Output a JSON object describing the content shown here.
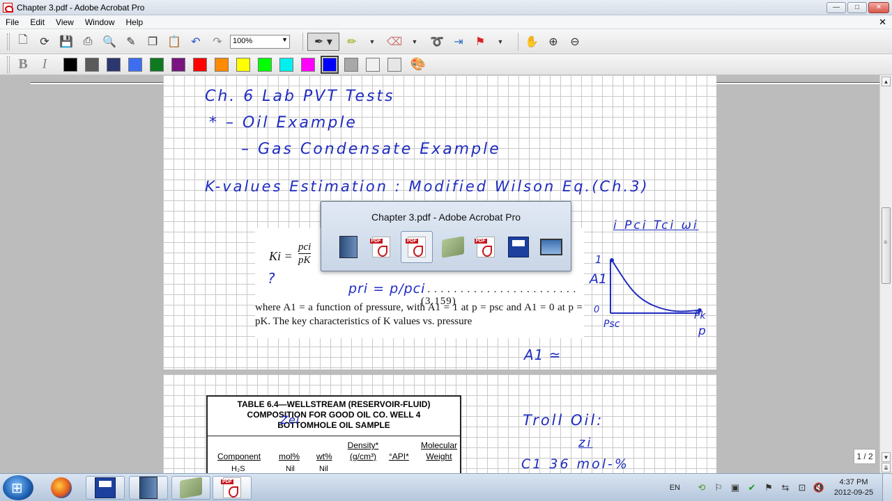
{
  "window": {
    "title": "Chapter 3.pdf - Adobe Acrobat Pro",
    "min": "—",
    "max": "□",
    "close": "✕"
  },
  "menu": {
    "items": [
      "File",
      "Edit",
      "View",
      "Window",
      "Help"
    ],
    "close_doc": "✕"
  },
  "toolbar": {
    "zoom_value": "100%",
    "icons": [
      "create-icon",
      "organizer-icon",
      "save-icon",
      "print-icon",
      "search-icon",
      "tools-icon",
      "copy-icon",
      "paste-icon",
      "undo-icon",
      "redo-icon"
    ],
    "annot_icons": [
      "pen-icon",
      "highlighter-icon",
      "eraser-icon",
      "lasso-icon",
      "insert-space-icon",
      "flag-icon",
      "hand-icon",
      "zoom-in-icon",
      "zoom-out-icon"
    ]
  },
  "format_toolbar": {
    "bold": "B",
    "italic": "I",
    "colors": [
      "#000000",
      "#5a5a5a",
      "#2c3770",
      "#3d6ef0",
      "#0d7a1f",
      "#7a1480",
      "#ff0000",
      "#ff8a00",
      "#ffff00",
      "#00ff00",
      "#00f0f0",
      "#ff00ff",
      "#0000ff",
      "#a8a8a8",
      "#f0f0f0",
      "#e6e6e6"
    ],
    "selected_color": "#0000ff"
  },
  "handwriting": {
    "line1": "Ch. 6   Lab PVT Tests",
    "line2": "*  – Oil Example",
    "line3": "– Gas Condensate Example",
    "line4": "K-values  Estimation  :  Modified Wilson Eq.(Ch.3)",
    "props": "i  Pci  Tci  ωi",
    "note_q": "?",
    "pr_def": "pri = p/pci",
    "a1_label": "A1",
    "tick_1": "1",
    "tick_0": "0",
    "psc": "Psc",
    "pk": "Pk",
    "p_axis": "p",
    "a1_approx": "A1 ≃",
    "troll": "Troll Oil:",
    "zi": "zi",
    "c1_row": "C1    36  mol-%",
    "zei": "Zei"
  },
  "equation": {
    "lhs": "Ki =",
    "frac_num": "pci",
    "frac_den": "pK",
    "eq_number": "(3.159)",
    "body": "where A1 = a function of pressure, with A1 = 1 at p = psc and A1 = 0 at p = pK. The key characteristics of K values vs. pressure"
  },
  "table": {
    "title_line1": "TABLE 6.4—WELLSTREAM (RESERVOIR-FLUID)",
    "title_line2": "COMPOSITION FOR GOOD OIL CO. WELL 4",
    "title_line3": "BOTTOMHOLE OIL SAMPLE",
    "headers": [
      "Component",
      "mol%",
      "wt%",
      "Density* (g/cm³)",
      "°API*",
      "Molecular Weight"
    ],
    "first_row": [
      "H₂S",
      "Nil",
      "Nil"
    ]
  },
  "switcher": {
    "title": "Chapter 3.pdf - Adobe Acrobat Pro"
  },
  "page_counter": "1 / 2",
  "taskbar": {
    "lang": "EN",
    "time": "4:37 PM",
    "date": "2012-09-25"
  }
}
